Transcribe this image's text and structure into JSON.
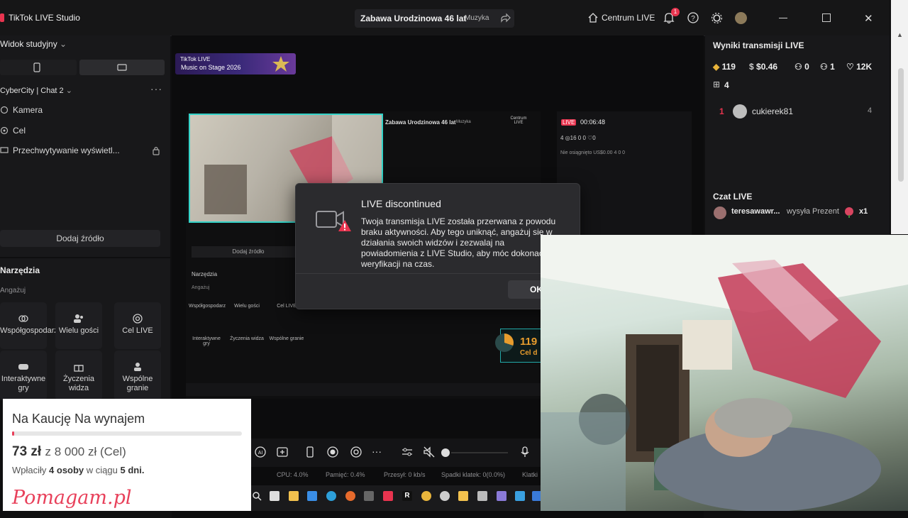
{
  "app": {
    "title": "TikTok LIVE Studio",
    "stream_title": "Zabawa Urodzinowa 46 lat",
    "stream_category": "Muzyka",
    "centrum_label": "Centrum LIVE",
    "notification_count": "1"
  },
  "left_panel": {
    "studio_view": "Widok studyjny",
    "scene_name": "CyberCity | Chat 2",
    "sources": [
      "Kamera",
      "Cel",
      "Przechwytywanie wyświetl..."
    ],
    "add_source": "Dodaj źródło",
    "tools_title": "Narzędzia",
    "tools_engage": "Angażuj",
    "tools": [
      {
        "label": "Współgospodarz",
        "icon": "cohost-icon"
      },
      {
        "label": "Wielu gości",
        "icon": "multi-guest-icon"
      },
      {
        "label": "Cel LIVE",
        "icon": "target-icon"
      },
      {
        "label": "Interaktywne gry",
        "icon": "gamepad-icon"
      },
      {
        "label": "Życzenia widza",
        "icon": "gift-icon"
      },
      {
        "label": "Wspólne granie",
        "icon": "co-play-icon"
      }
    ]
  },
  "banner": {
    "brand": "TikTok LIVE",
    "text": "Music on Stage 2026"
  },
  "nested_screen": {
    "title": "Zabawa Urodzinowa 46 lat",
    "category": "Muzyka",
    "centrum": "Centrum LIVE",
    "live_badge": "LIVE",
    "timer": "00:06:48",
    "stats": "4  ◎16  0  0  ♡0",
    "stats2": "Nie osiągnięto  US$0.00  4  0  0",
    "add_source": "Dodaj źródło",
    "tools": "Narzędzia",
    "engage": "Angażuj",
    "tiles": [
      "Współgospodarz",
      "Wielu gości",
      "Cel LIVE",
      "Interaktywne gry",
      "Życzenia widza",
      "Wspólne granie"
    ],
    "goal_num": "119",
    "goal_label": "Cel d"
  },
  "dialog": {
    "title": "LIVE discontinued",
    "body": "Twoja transmisja LIVE została przerwana z powodu braku aktywności. Aby tego uniknąć, angażuj się w działania swoich widzów i zezwalaj na powiadomienia z LIVE Studio, aby móc dokonać weryfikacji na czas.",
    "ok": "OK"
  },
  "results": {
    "title": "Wyniki transmisji LIVE",
    "diamonds": "119",
    "earnings": "$0.46",
    "viewers": "0",
    "followers": "1",
    "likes": "12K",
    "gifts": "4",
    "ranking": [
      {
        "rank": "1",
        "name": "cukierek81",
        "score": "4"
      }
    ]
  },
  "chat": {
    "title": "Czat LIVE",
    "user": "teresawawr...",
    "message": "wysyła Prezent",
    "count": "x1"
  },
  "stats_bar": {
    "cpu": "CPU: 4.0%",
    "memory": "Pamięć: 0.4%",
    "bandwidth": "Przesył: 0 kb/s",
    "frames": "Spadki klatek: 0(0.0%)",
    "extra": "Klatki"
  },
  "fundraiser": {
    "title": "Na Kaucję Na wynajem",
    "raised": "73 zł",
    "goal_text": "z 8 000 zł (Cel)",
    "payers_prefix": "Wpłaciły",
    "payers_count": "4 osoby",
    "payers_mid": "w ciągu",
    "payers_days": "5 dni.",
    "logo": "Pomagam.pl",
    "progress_fraction": 0.009
  },
  "colors": {
    "accent": "#e8344f",
    "teal": "#34d3c8",
    "gold": "#e89c2d",
    "panel": "#18181a"
  }
}
